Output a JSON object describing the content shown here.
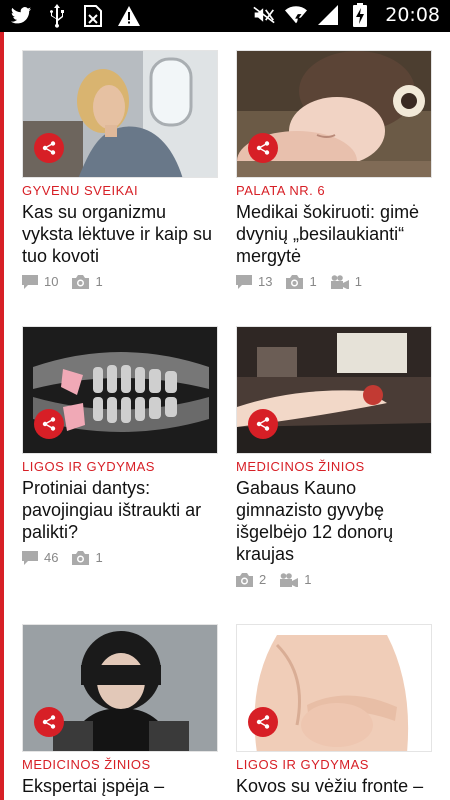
{
  "status_bar": {
    "time": "20:08",
    "left_icons": [
      "twitter-icon",
      "usb-icon",
      "sim-icon",
      "warning-icon"
    ],
    "right_icons": [
      "mute-icon",
      "wifi-icon",
      "signal-icon",
      "battery-charging-icon"
    ]
  },
  "colors": {
    "accent": "#d71f26",
    "meta": "#888888"
  },
  "articles": [
    {
      "category": "GYVENU SVEIKAI",
      "title": "Kas su organizmu vyksta lėktuve ir kaip su tuo kovoti",
      "comments": "10",
      "photos": "1",
      "videos": ""
    },
    {
      "category": "PALATA NR. 6",
      "title": "Medikai šokiruoti: gimė dvynių „besilaukianti“ mergytė",
      "comments": "13",
      "photos": "1",
      "videos": "1"
    },
    {
      "category": "LIGOS IR GYDYMAS",
      "title": "Protiniai dantys: pavojingiau ištraukti ar palikti?",
      "comments": "46",
      "photos": "1",
      "videos": ""
    },
    {
      "category": "MEDICINOS ŽINIOS",
      "title": "Gabaus Kauno gimnazisto gyvybę išgelbėjo 12 donorų kraujas",
      "comments": "",
      "photos": "2",
      "videos": "1"
    },
    {
      "category": "MEDICINOS ŽINIOS",
      "title": "Ekspertai įspėja – ",
      "comments": "",
      "photos": "",
      "videos": ""
    },
    {
      "category": "LIGOS IR GYDYMAS",
      "title": "Kovos su vėžiu fronte –",
      "comments": "",
      "photos": "",
      "videos": ""
    }
  ]
}
